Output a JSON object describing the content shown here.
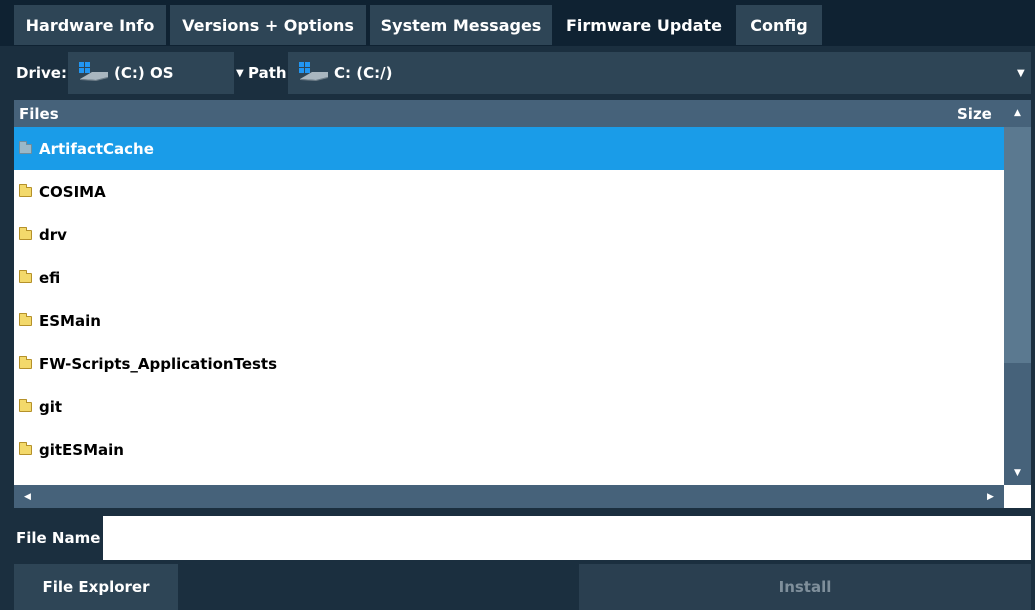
{
  "tabs": [
    {
      "label": "Hardware Info"
    },
    {
      "label": "Versions + Options"
    },
    {
      "label": "System Messages"
    },
    {
      "label": "Firmware Update",
      "active": true
    },
    {
      "label": "Config"
    }
  ],
  "pathbar": {
    "drive_label": "Drive:",
    "drive_value": "(C:) OS",
    "path_label": "Path:",
    "path_value": "C: (C:/)"
  },
  "list": {
    "header_files": "Files",
    "header_size": "Size",
    "items": [
      {
        "name": "ArtifactCache",
        "selected": true
      },
      {
        "name": "COSIMA"
      },
      {
        "name": "drv"
      },
      {
        "name": "efi"
      },
      {
        "name": "ESMain"
      },
      {
        "name": "FW-Scripts_ApplicationTests"
      },
      {
        "name": "git"
      },
      {
        "name": "gitESMain"
      }
    ]
  },
  "file_name": {
    "label": "File Name",
    "value": ""
  },
  "buttons": {
    "file_explorer": "File Explorer",
    "install": "Install"
  },
  "colors": {
    "background": "#1b2f3f",
    "tab": "#2e4556",
    "selection": "#1a9ce8",
    "disabled_text": "#7f8f9b"
  }
}
